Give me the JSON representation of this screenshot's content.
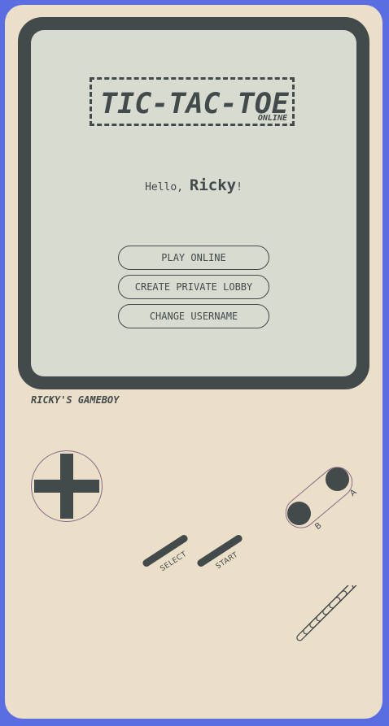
{
  "screen": {
    "logo_title": "TIC-TAC-TOE",
    "logo_subtitle": "ONLINE",
    "greeting_prefix": "Hello, ",
    "username": "Ricky",
    "greeting_suffix": "!",
    "menu": [
      {
        "label": "PLAY ONLINE"
      },
      {
        "label": "CREATE PRIVATE LOBBY"
      },
      {
        "label": "CHANGE USERNAME"
      }
    ]
  },
  "console": {
    "brand": "RICKY'S GAMEBOY",
    "button_a": "A",
    "button_b": "B",
    "select_label": "SELECT",
    "start_label": "START"
  },
  "colors": {
    "background": "#5b6ee1",
    "body": "#ecdfc9",
    "dark": "#434a4c",
    "screen": "#d8dbd0"
  },
  "icons": [
    "dpad-icon",
    "speaker-grille-icon"
  ]
}
